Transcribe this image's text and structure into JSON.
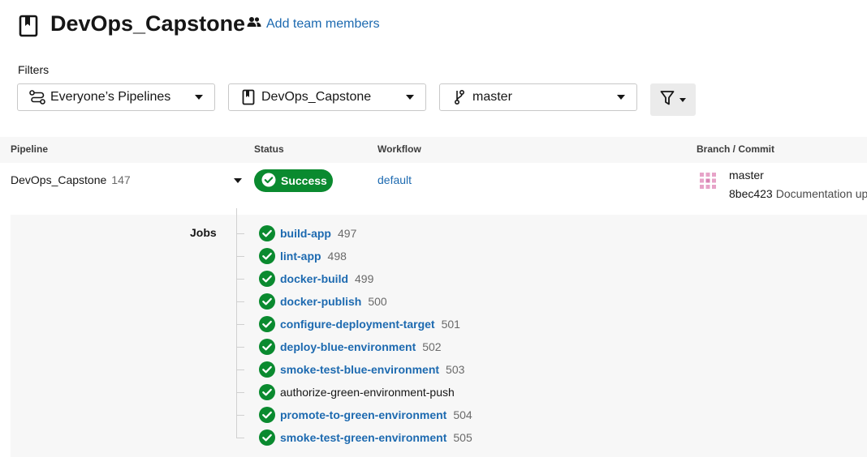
{
  "header": {
    "title": "DevOps_Capstone",
    "add_team_label": "Add team members"
  },
  "filters": {
    "label": "Filters",
    "pipelines": "Everyone’s Pipelines",
    "project": "DevOps_Capstone",
    "branch": "master"
  },
  "table": {
    "headers": {
      "pipeline": "Pipeline",
      "status": "Status",
      "workflow": "Workflow",
      "branch_commit": "Branch / Commit"
    },
    "row": {
      "project": "DevOps_Capstone",
      "number": "147",
      "status": "Success",
      "workflow": "default",
      "branch": "master",
      "commit_hash": "8bec423",
      "commit_message": "Documentation up"
    }
  },
  "jobs": {
    "label": "Jobs",
    "items": [
      {
        "name": "build-app",
        "number": "497"
      },
      {
        "name": "lint-app",
        "number": "498"
      },
      {
        "name": "docker-build",
        "number": "499"
      },
      {
        "name": "docker-publish",
        "number": "500"
      },
      {
        "name": "configure-deployment-target",
        "number": "501"
      },
      {
        "name": "deploy-blue-environment",
        "number": "502"
      },
      {
        "name": "smoke-test-blue-environment",
        "number": "503"
      },
      {
        "name": "authorize-green-environment-push",
        "number": ""
      },
      {
        "name": "promote-to-green-environment",
        "number": "504"
      },
      {
        "name": "smoke-test-green-environment",
        "number": "505"
      }
    ]
  },
  "colors": {
    "success": "#0a8a2f",
    "link": "#1d6ab0",
    "panel_bg": "#f7f7f7"
  },
  "icons": {
    "project": "project-bookmark-icon",
    "team": "people-icon",
    "pipelines_filter": "pipelines-icon",
    "branch": "git-branch-icon",
    "filter": "funnel-icon",
    "status": "check-circle-icon"
  }
}
